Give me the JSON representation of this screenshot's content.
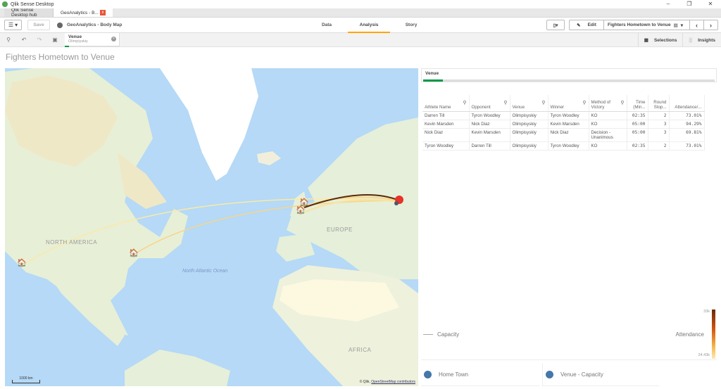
{
  "window": {
    "title": "Qlik Sense Desktop",
    "controls": [
      "minimize-icon",
      "restore-icon",
      "close-icon"
    ]
  },
  "browser_tabs": [
    {
      "label": "Qlik Sense Desktop hub",
      "active": false
    },
    {
      "label": "GeoAnalytics - B...",
      "active": true,
      "close": "x"
    }
  ],
  "toolbar": {
    "menu_icon": "hamburger-icon",
    "save_label": "Save",
    "app_name": "GeoAnalytics - Body Map",
    "nav_tabs": [
      {
        "label": "Data",
        "active": false
      },
      {
        "label": "Analysis",
        "active": true
      },
      {
        "label": "Story",
        "active": false
      }
    ],
    "edit_label": "Edit",
    "sheet_name": "Fighters Hometown to Venue",
    "accent_color": "#ffa500"
  },
  "selection_bar": {
    "tools": [
      "smart-search-icon",
      "step-back-icon",
      "step-forward-icon",
      "clear-selections-icon"
    ],
    "chip": {
      "field": "Venue",
      "value": "Olimpiyskiy"
    },
    "selections_label": "Selections",
    "insights_label": "Insights"
  },
  "sheet_title": "Fighters Hometown to Venue",
  "map": {
    "labels": {
      "north_america": "NORTH AMERICA",
      "europe": "EUROPE",
      "africa": "AFRICA",
      "ocean": "North Atlantic Ocean"
    },
    "scale": "1000 km",
    "attribution": "© Qlik,",
    "attribution_link": "OpenStreetMap contributors",
    "markers": {
      "home_towns": [
        "San Francisco area",
        "New York area",
        "Liverpool area",
        "Manchester area"
      ],
      "venue": "Moscow (Olimpiyskiy)"
    },
    "venue_color": "#e8322a"
  },
  "venue_filter": {
    "title": "Venue",
    "accent": "#009845"
  },
  "table": {
    "columns": [
      "Athlete Name",
      "Opponent",
      "Venue",
      "Winner",
      "Method of Victory",
      "Time (Min...",
      "Round Stop...",
      "Attendance/..."
    ],
    "rows": [
      [
        "Darren Till",
        "Tyron Woodley",
        "Olimpisyskiy",
        "Tyron Woodley",
        "KO",
        "02:35",
        "2",
        "73.01%"
      ],
      [
        "Kevin Marsden",
        "Nick Diaz",
        "Olimpisyskiy",
        "Kevin Marsden",
        "KO",
        "05:00",
        "3",
        "94.29%"
      ],
      [
        "Nick Diaz",
        "Kevin Marsden",
        "Olimpisyskiy",
        "Nick Diaz",
        "Decision - Unanimous",
        "05:00",
        "3",
        "69.81%"
      ],
      [
        "Tyron Woodley",
        "Darren Till",
        "Olimpisyskiy",
        "Tyron Woodley",
        "KO",
        "02:35",
        "2",
        "73.01%"
      ]
    ]
  },
  "legend": {
    "capacity_label": "Capacity",
    "attendance_label": "Attendance",
    "attendance_max": "33k",
    "attendance_min": "24.43k",
    "home_town_label": "Home Town",
    "venue_capacity_label": "Venue - Capacity",
    "dot_color": "#4477aa"
  }
}
